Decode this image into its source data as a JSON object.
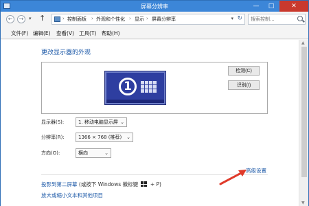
{
  "window": {
    "title": "屏幕分辨率",
    "minimize": "—",
    "maximize": "□",
    "close": "✕"
  },
  "nav": {
    "back": "←",
    "forward": "→",
    "up": "↑"
  },
  "breadcrumb": {
    "items": [
      "控制面板",
      "外观和个性化",
      "显示",
      "屏幕分辨率"
    ],
    "separator": "›"
  },
  "search": {
    "placeholder": "搜索控制..."
  },
  "menu": {
    "items": [
      "文件(F)",
      "编辑(E)",
      "查看(V)",
      "工具(T)",
      "帮助(H)"
    ]
  },
  "page": {
    "title": "更改显示器的外观"
  },
  "preview": {
    "monitor_number": "1",
    "detect_label": "检测(C)",
    "identify_label": "识别(I)"
  },
  "settings": {
    "display": {
      "label": "显示器(S):",
      "value": "1. 移动电脑显示屏"
    },
    "resolution": {
      "label": "分辨率(R):",
      "value": "1366 × 768 (推荐)"
    },
    "orientation": {
      "label": "方向(O):",
      "value": "横向"
    }
  },
  "links": {
    "advanced": "高级设置",
    "project_link": "投影到第二屏幕",
    "project_hint_before": "(或按下 Windows 徽标键",
    "project_hint_after": "+ P)",
    "text_size": "放大或缩小文本和其他项目"
  },
  "colors": {
    "accent": "#1e5aa8",
    "titlebar": "#3c86d8",
    "annotation_arrow": "#e03a2a"
  },
  "icons": [
    "app-icon",
    "back-icon",
    "forward-icon",
    "up-arrow-icon",
    "control-panel-icon",
    "refresh-icon",
    "search-icon",
    "monitor-icon",
    "windows-logo-icon",
    "chevron-down-icon"
  ]
}
